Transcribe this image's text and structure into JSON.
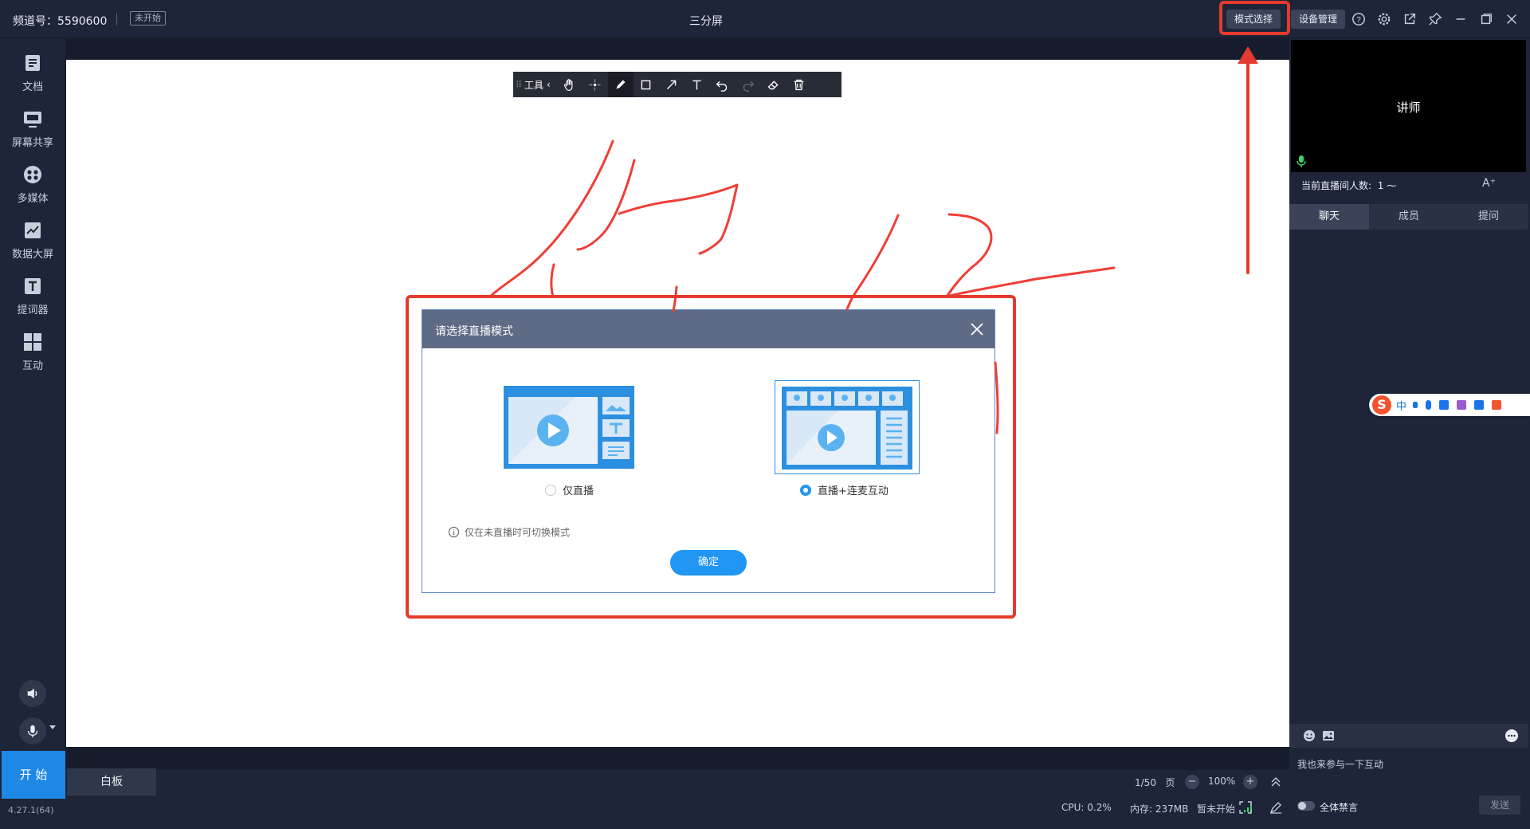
{
  "topbar": {
    "channel_label": "频道号：5590600",
    "status_badge": "未开始",
    "title": "三分屏",
    "mode_select_label": "模式选择",
    "device_manage_label": "设备管理",
    "icons": [
      "help-icon",
      "settings-icon",
      "popout-icon",
      "pin-icon",
      "minimize-icon",
      "maximize-icon",
      "close-icon"
    ]
  },
  "sidebar": {
    "items": [
      {
        "label": "文档",
        "icon": "document-icon"
      },
      {
        "label": "屏幕共享",
        "icon": "screen-share-icon"
      },
      {
        "label": "多媒体",
        "icon": "multimedia-icon"
      },
      {
        "label": "数据大屏",
        "icon": "data-screen-icon"
      },
      {
        "label": "提词器",
        "icon": "teleprompter-icon"
      },
      {
        "label": "互动",
        "icon": "interaction-icon"
      }
    ],
    "start_label": "开 始",
    "version": "4.27.1(64)"
  },
  "whiteboard_toolbar": {
    "tools_label": "工具",
    "tools": [
      "hand-icon",
      "laser-pointer-icon",
      "pen-icon",
      "rectangle-icon",
      "arrow-icon",
      "text-icon",
      "undo-icon",
      "redo-icon",
      "eraser-icon",
      "trash-icon"
    ],
    "active_tool": "pen-icon"
  },
  "dialog": {
    "title": "请选择直播模式",
    "options": [
      {
        "label": "仅直播",
        "selected": false
      },
      {
        "label": "直播+连麦互动",
        "selected": true
      }
    ],
    "hint": "仅在未直播时可切换模式",
    "confirm_label": "确定"
  },
  "bottombar": {
    "tab_label": "白板",
    "page_current": "1/50",
    "page_unit": "页",
    "zoom_minus": "−",
    "zoom_value": "100%",
    "zoom_plus": "+",
    "cpu": "CPU: 0.2%",
    "memory": "内存: 237MB",
    "live_status": "暂未开始"
  },
  "right_panel": {
    "video_name": "讲师",
    "viewer_label": "当前直播间人数:",
    "viewer_count": "1",
    "font_size_label": "A⁺",
    "tabs": [
      "聊天",
      "成员",
      "提问"
    ],
    "active_tab": "聊天",
    "chat_placeholder": "我也来参与一下互动",
    "mute_all_label": "全体禁言",
    "send_label": "发送"
  },
  "ime": {
    "lang_label": "中"
  },
  "colors": {
    "accent": "#2196f3",
    "background": "#1e2538",
    "annotation_red": "#ef3e36",
    "dialog_header": "#5f6a85"
  }
}
